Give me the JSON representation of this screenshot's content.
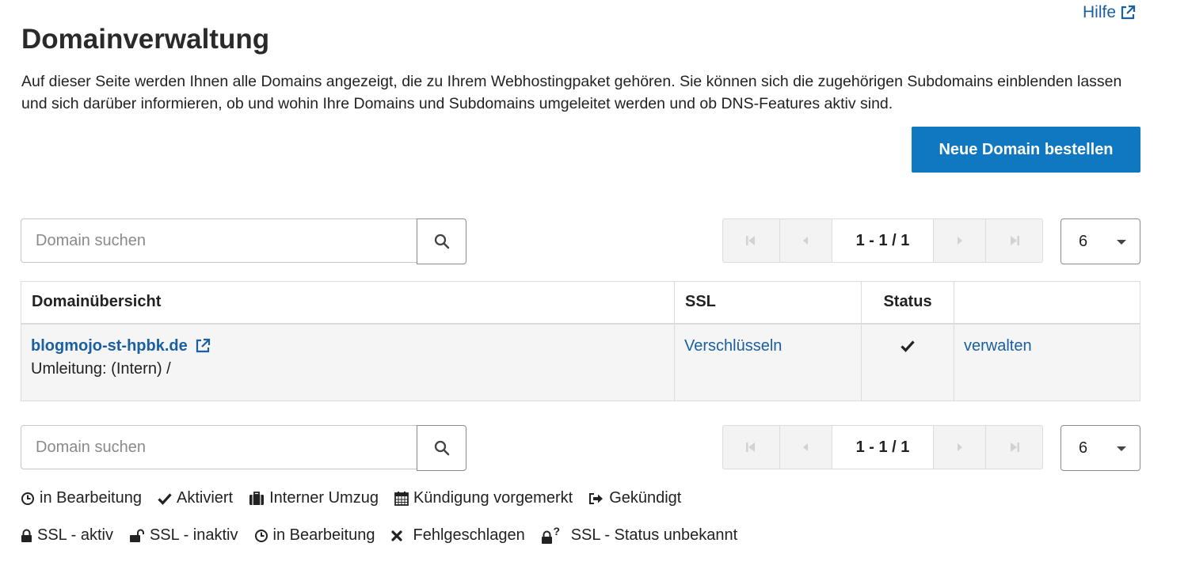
{
  "header": {
    "help_label": "Hilfe",
    "title": "Domainverwaltung",
    "intro_text": "Auf dieser Seite werden Ihnen alle Domains angezeigt, die zu Ihrem Webhostingpaket gehören. Sie können sich die zugehörigen Subdomains einblenden lassen und sich darüber informieren, ob und wohin Ihre Domains und Subdomains umgeleitet werden und ob DNS-Features aktiv sind.",
    "order_button_label": "Neue Domain bestellen"
  },
  "toolbar": {
    "search_placeholder": "Domain suchen",
    "pagination_info": "1 - 1 / 1",
    "page_size": "6"
  },
  "table": {
    "columns": [
      "Domainübersicht",
      "SSL",
      "Status",
      ""
    ],
    "rows": [
      {
        "domain": "blogmojo-st-hpbk.de",
        "redirect": "Umleitung: (Intern) /",
        "ssl_action": "Verschlüsseln",
        "status_icon": "check-icon",
        "action": "verwalten"
      }
    ]
  },
  "legend_status": [
    {
      "icon": "clock-icon",
      "label": "in Bearbeitung"
    },
    {
      "icon": "check-icon",
      "label": "Aktiviert"
    },
    {
      "icon": "suitcase-icon",
      "label": "Interner Umzug"
    },
    {
      "icon": "calendar-icon",
      "label": "Kündigung vorgemerkt"
    },
    {
      "icon": "sign-out-icon",
      "label": "Gekündigt"
    }
  ],
  "legend_ssl": [
    {
      "icon": "lock-icon",
      "label": "SSL - aktiv"
    },
    {
      "icon": "unlock-icon",
      "label": "SSL - inaktiv"
    },
    {
      "icon": "clock-icon",
      "label": "in Bearbeitung"
    },
    {
      "icon": "times-icon",
      "label": "Fehlgeschlagen"
    },
    {
      "icon": "lock-question-icon",
      "label": "SSL - Status unbekannt"
    }
  ],
  "colors": {
    "link": "#1a5fa0",
    "primary_button": "#0f78c0",
    "row_background": "#f5f5f5"
  }
}
